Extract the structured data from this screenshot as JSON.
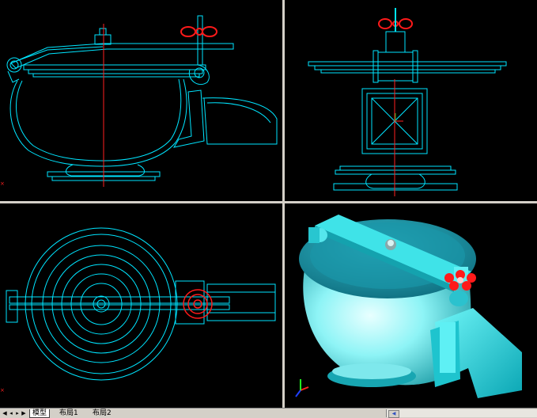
{
  "app": {
    "background_color": "#d4d0c8",
    "viewport_bg": "#000000",
    "line_color": "#00e5ff",
    "valve_color": "#ff1a1a",
    "axis_color": "#ff2020",
    "shaded_body_color": "#5ff0f5"
  },
  "viewports": [
    {
      "name": "front-view",
      "icon": "ucs-icon"
    },
    {
      "name": "side-view",
      "icon": "ucs-icon"
    },
    {
      "name": "top-view",
      "icon": "ucs-icon"
    },
    {
      "name": "shaded-3d-view",
      "icon": "ucs-3d-icon"
    }
  ],
  "layout_tabs": [
    {
      "label": "模型",
      "active": true
    },
    {
      "label": "布局1",
      "active": false
    },
    {
      "label": "布局2",
      "active": false
    }
  ],
  "nav_buttons": [
    "first-tab-icon",
    "prev-tab-icon",
    "next-tab-icon",
    "last-tab-icon"
  ],
  "scrollbar": {
    "icon": "scroll-left-icon"
  }
}
